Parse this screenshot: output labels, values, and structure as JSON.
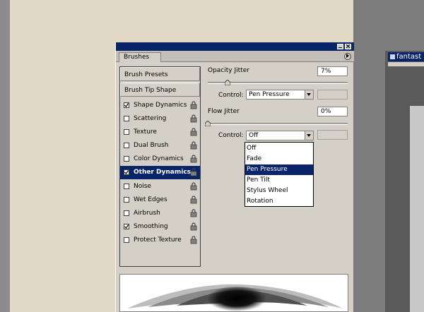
{
  "background": {
    "workspace_color": "#e2dac7",
    "window_tab": {
      "label": "fantast"
    }
  },
  "palette": {
    "tab_label": "Brushes",
    "title_color": "#0a246a",
    "left_panel": {
      "brush_presets": "Brush Presets",
      "brush_tip_shape": "Brush Tip Shape",
      "group1": [
        {
          "label": "Shape Dynamics",
          "checked": true,
          "selected": false
        },
        {
          "label": "Scattering",
          "checked": false,
          "selected": false
        },
        {
          "label": "Texture",
          "checked": false,
          "selected": false
        },
        {
          "label": "Dual Brush",
          "checked": false,
          "selected": false
        },
        {
          "label": "Color Dynamics",
          "checked": false,
          "selected": false
        },
        {
          "label": "Other Dynamics",
          "checked": true,
          "selected": true
        }
      ],
      "group2": [
        {
          "label": "Noise",
          "checked": false
        },
        {
          "label": "Wet Edges",
          "checked": false
        },
        {
          "label": "Airbrush",
          "checked": false
        },
        {
          "label": "Smoothing",
          "checked": true
        },
        {
          "label": "Protect Texture",
          "checked": false
        }
      ]
    },
    "opacity_jitter": {
      "label": "Opacity Jitter",
      "value": "7%",
      "slider_fraction": 0.07,
      "control_label": "Control:",
      "control_value": "Pen Pressure"
    },
    "flow_jitter": {
      "label": "Flow Jitter",
      "value": "0%",
      "slider_fraction": 0,
      "control_label": "Control:",
      "control_value": "Off"
    },
    "dropdown_options": [
      {
        "label": "Off",
        "highlighted": false
      },
      {
        "label": "Fade",
        "highlighted": false
      },
      {
        "label": "Pen Pressure",
        "highlighted": true
      },
      {
        "label": "Pen Tilt",
        "highlighted": false
      },
      {
        "label": "Stylus Wheel",
        "highlighted": false
      },
      {
        "label": "Rotation",
        "highlighted": false
      }
    ]
  }
}
